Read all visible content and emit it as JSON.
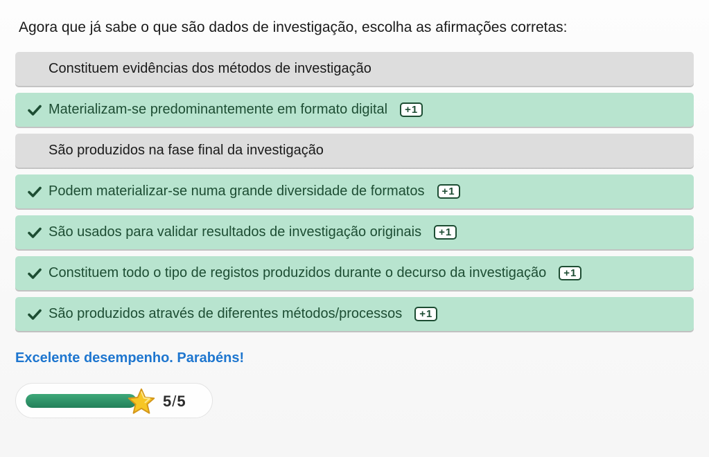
{
  "question": "Agora que já sabe o que são dados de investigação, escolha as afirmações corretas:",
  "options": [
    {
      "label": "Constituem evidências dos métodos de investigação",
      "correct": false
    },
    {
      "label": "Materializam-se predominantemente em formato digital",
      "correct": true,
      "points": "+1"
    },
    {
      "label": "São produzidos na fase final da investigação",
      "correct": false
    },
    {
      "label": "Podem materializar-se numa grande diversidade de formatos",
      "correct": true,
      "points": "+1"
    },
    {
      "label": "São usados para validar resultados de investigação originais",
      "correct": true,
      "points": "+1"
    },
    {
      "label": "Constituem todo o tipo de registos produzidos durante o decurso da investigação",
      "correct": true,
      "points": "+1"
    },
    {
      "label": "São produzidos através de diferentes métodos/processos",
      "correct": true,
      "points": "+1"
    }
  ],
  "feedback": "Excelente desempenho. Parabéns!",
  "score": {
    "current": "5",
    "separator": "/",
    "total": "5",
    "progress_fraction": 1.0
  },
  "icons": {
    "check": "checkmark-icon",
    "star": "star-icon"
  },
  "colors": {
    "correct_bg": "#b8e4cf",
    "correct_text": "#1d4d33",
    "neutral_bg": "#dddddd",
    "feedback": "#1e76cf",
    "progress": "#2e9466",
    "star": "#f7c623"
  }
}
